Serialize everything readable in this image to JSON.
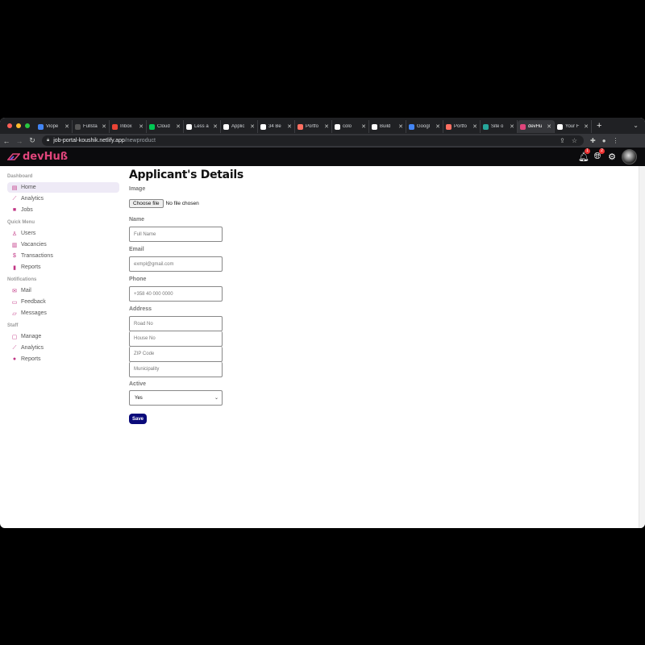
{
  "browser": {
    "tabs": [
      {
        "title": "Viope",
        "color": "#4285f4"
      },
      {
        "title": "Fullsta",
        "color": "#555555"
      },
      {
        "title": "Inbox",
        "color": "#ea4335"
      },
      {
        "title": "Cloud",
        "color": "#00c853"
      },
      {
        "title": "Less a",
        "color": "#ffffff"
      },
      {
        "title": "Applic",
        "color": "#ffffff"
      },
      {
        "title": "34 Be",
        "color": "#ffffff"
      },
      {
        "title": "Portfo",
        "color": "#ff6f61"
      },
      {
        "title": "colo",
        "color": "#ffffff"
      },
      {
        "title": "Build",
        "color": "#ffffff"
      },
      {
        "title": "Googl",
        "color": "#4285f4"
      },
      {
        "title": "Portfo",
        "color": "#ff6f61"
      },
      {
        "title": "Site o",
        "color": "#26a69a"
      },
      {
        "title": "devHu",
        "color": "#e0457b",
        "active": true
      },
      {
        "title": "Your F",
        "color": "#ffffff"
      }
    ],
    "url_host": "job-portal-koushik.netlify.app",
    "url_path": "/newproduct"
  },
  "app": {
    "logo_text": "devHuß",
    "brand_color": "#e0457b",
    "notification_count": "1",
    "language_count": "2"
  },
  "sidebar": {
    "sections": [
      {
        "title": "Dashboard",
        "items": [
          {
            "label": "Home",
            "icon": "home-icon",
            "glyph": "▤",
            "active": true
          },
          {
            "label": "Analytics",
            "icon": "trending-up-icon",
            "glyph": "⟋"
          },
          {
            "label": "Jobs",
            "icon": "briefcase-icon",
            "glyph": "■"
          }
        ]
      },
      {
        "title": "Quick Menu",
        "items": [
          {
            "label": "Users",
            "icon": "user-icon",
            "glyph": "♙"
          },
          {
            "label": "Vacancies",
            "icon": "building-icon",
            "glyph": "▥"
          },
          {
            "label": "Transactions",
            "icon": "dollar-icon",
            "glyph": "$"
          },
          {
            "label": "Reports",
            "icon": "bar-chart-icon",
            "glyph": "▮"
          }
        ]
      },
      {
        "title": "Notifications",
        "items": [
          {
            "label": "Mail",
            "icon": "mail-icon",
            "glyph": "✉"
          },
          {
            "label": "Feedback",
            "icon": "feedback-icon",
            "glyph": "▭"
          },
          {
            "label": "Messages",
            "icon": "message-icon",
            "glyph": "▱"
          }
        ]
      },
      {
        "title": "Staff",
        "items": [
          {
            "label": "Manage",
            "icon": "work-icon",
            "glyph": "▢"
          },
          {
            "label": "Analytics",
            "icon": "timeline-icon",
            "glyph": "⟋"
          },
          {
            "label": "Reports",
            "icon": "report-icon",
            "glyph": "●"
          }
        ]
      }
    ]
  },
  "form": {
    "title": "Applicant's Details",
    "image_label": "Image",
    "file_button": "Choose file",
    "file_status": "No file chosen",
    "name_label": "Name",
    "name_placeholder": "Full Name",
    "email_label": "Email",
    "email_placeholder": "exmpl@gmail.com",
    "phone_label": "Phone",
    "phone_placeholder": "+358 40 000 0000",
    "address_label": "Address",
    "road_placeholder": "Road No",
    "house_placeholder": "House No",
    "zip_placeholder": "ZIP Code",
    "municipality_placeholder": "Municipality",
    "active_label": "Active",
    "active_value": "Yes",
    "save_label": "Save"
  }
}
